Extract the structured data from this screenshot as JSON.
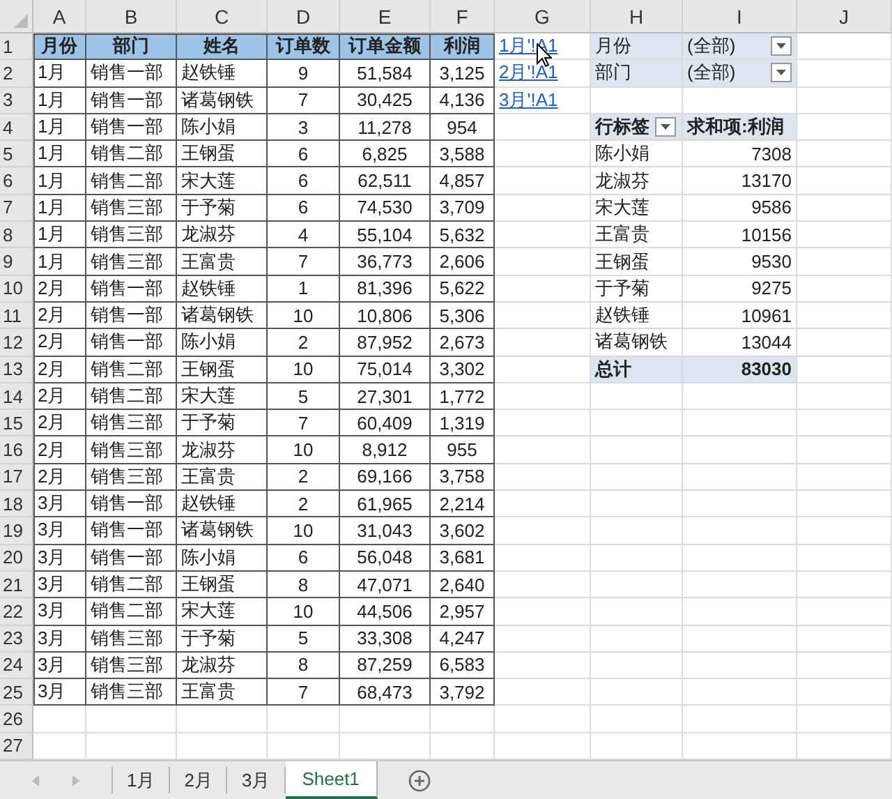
{
  "column_headers": [
    "A",
    "B",
    "C",
    "D",
    "E",
    "F",
    "G",
    "H",
    "I",
    "J"
  ],
  "row_numbers": [
    "1",
    "2",
    "3",
    "4",
    "5",
    "6",
    "7",
    "8",
    "9",
    "10",
    "11",
    "12",
    "13",
    "14",
    "15",
    "16",
    "17",
    "18",
    "19",
    "20",
    "21",
    "22",
    "23",
    "24",
    "25",
    "26",
    "27"
  ],
  "table": {
    "columns": [
      "月份",
      "部门",
      "姓名",
      "订单数",
      "订单金额",
      "利润"
    ],
    "rows": [
      [
        "1月",
        "销售一部",
        "赵铁锤",
        "9",
        "51,584",
        "3,125"
      ],
      [
        "1月",
        "销售一部",
        "诸葛钢铁",
        "7",
        "30,425",
        "4,136"
      ],
      [
        "1月",
        "销售一部",
        "陈小娟",
        "3",
        "11,278",
        "954"
      ],
      [
        "1月",
        "销售二部",
        "王钢蛋",
        "6",
        "6,825",
        "3,588"
      ],
      [
        "1月",
        "销售二部",
        "宋大莲",
        "6",
        "62,511",
        "4,857"
      ],
      [
        "1月",
        "销售三部",
        "于予菊",
        "6",
        "74,530",
        "3,709"
      ],
      [
        "1月",
        "销售三部",
        "龙淑芬",
        "4",
        "55,104",
        "5,632"
      ],
      [
        "1月",
        "销售三部",
        "王富贵",
        "7",
        "36,773",
        "2,606"
      ],
      [
        "2月",
        "销售一部",
        "赵铁锤",
        "1",
        "81,396",
        "5,622"
      ],
      [
        "2月",
        "销售一部",
        "诸葛钢铁",
        "10",
        "10,806",
        "5,306"
      ],
      [
        "2月",
        "销售一部",
        "陈小娟",
        "2",
        "87,952",
        "2,673"
      ],
      [
        "2月",
        "销售二部",
        "王钢蛋",
        "10",
        "75,014",
        "3,302"
      ],
      [
        "2月",
        "销售二部",
        "宋大莲",
        "5",
        "27,301",
        "1,772"
      ],
      [
        "2月",
        "销售三部",
        "于予菊",
        "7",
        "60,409",
        "1,319"
      ],
      [
        "2月",
        "销售三部",
        "龙淑芬",
        "10",
        "8,912",
        "955"
      ],
      [
        "2月",
        "销售三部",
        "王富贵",
        "2",
        "69,166",
        "3,758"
      ],
      [
        "3月",
        "销售一部",
        "赵铁锤",
        "2",
        "61,965",
        "2,214"
      ],
      [
        "3月",
        "销售一部",
        "诸葛钢铁",
        "10",
        "31,043",
        "3,602"
      ],
      [
        "3月",
        "销售一部",
        "陈小娟",
        "6",
        "56,048",
        "3,681"
      ],
      [
        "3月",
        "销售二部",
        "王钢蛋",
        "8",
        "47,071",
        "2,640"
      ],
      [
        "3月",
        "销售二部",
        "宋大莲",
        "10",
        "44,506",
        "2,957"
      ],
      [
        "3月",
        "销售三部",
        "于予菊",
        "5",
        "33,308",
        "4,247"
      ],
      [
        "3月",
        "销售三部",
        "龙淑芬",
        "8",
        "87,259",
        "6,583"
      ],
      [
        "3月",
        "销售三部",
        "王富贵",
        "7",
        "68,473",
        "3,792"
      ]
    ]
  },
  "links": [
    "1月'!A1",
    "2月'!A1",
    "3月'!A1"
  ],
  "pivot": {
    "filters": [
      {
        "field": "月份",
        "value": "(全部)"
      },
      {
        "field": "部门",
        "value": "(全部)"
      }
    ],
    "header": {
      "row_label": "行标签",
      "value_label": "求和项:利润"
    },
    "rows": [
      {
        "name": "陈小娟",
        "value": "7308"
      },
      {
        "name": "龙淑芬",
        "value": "13170"
      },
      {
        "name": "宋大莲",
        "value": "9586"
      },
      {
        "name": "王富贵",
        "value": "10156"
      },
      {
        "name": "王钢蛋",
        "value": "9530"
      },
      {
        "name": "于予菊",
        "value": "9275"
      },
      {
        "name": "赵铁锤",
        "value": "10961"
      },
      {
        "name": "诸葛钢铁",
        "value": "13044"
      }
    ],
    "total": {
      "label": "总计",
      "value": "83030"
    }
  },
  "sheet_tabs": [
    {
      "label": "1月",
      "selected": false
    },
    {
      "label": "2月",
      "selected": false
    },
    {
      "label": "3月",
      "selected": false
    },
    {
      "label": "Sheet1",
      "selected": true
    }
  ]
}
